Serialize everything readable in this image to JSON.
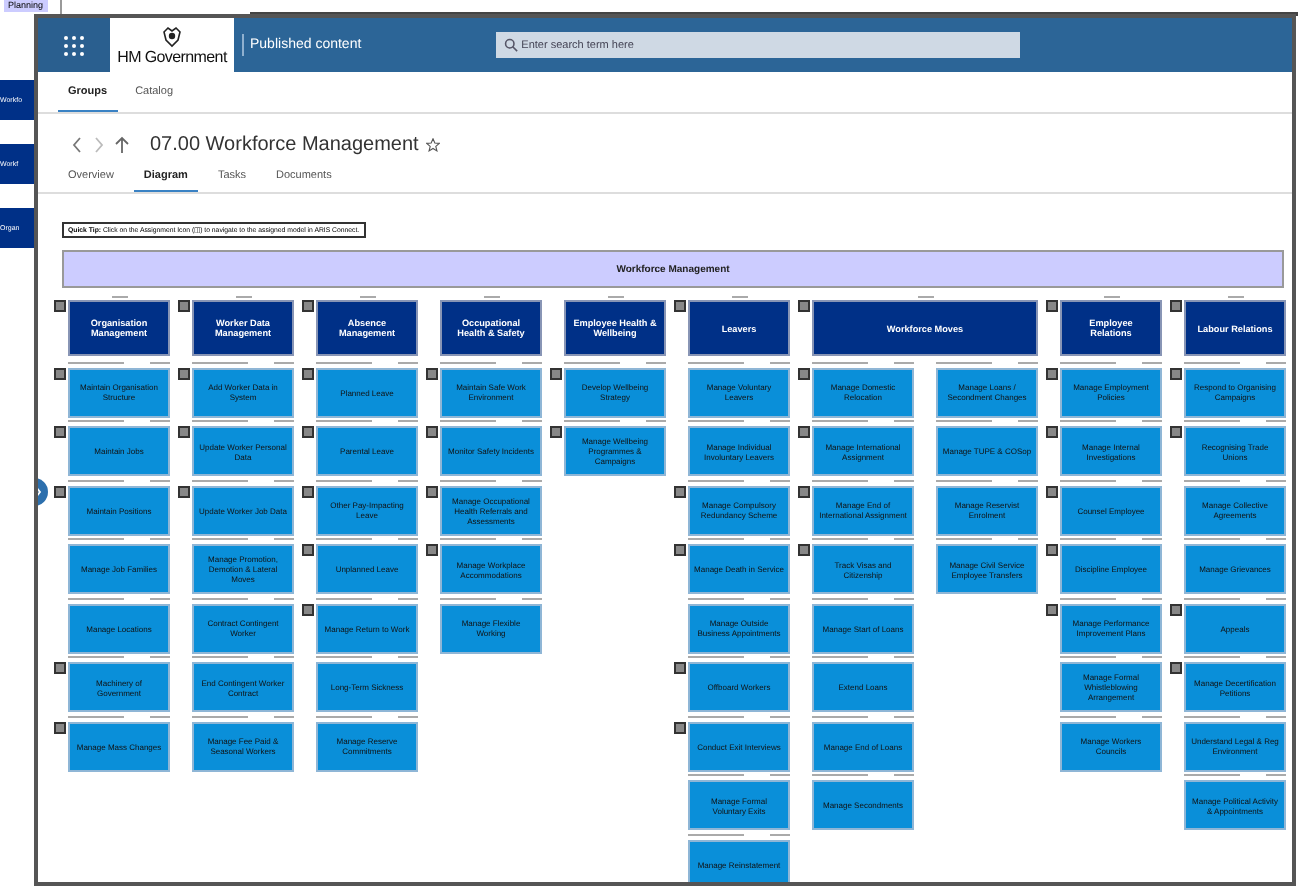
{
  "background_window": {
    "label": "Planning",
    "boxes": [
      "Workfo",
      "Workf",
      "Organ"
    ]
  },
  "header": {
    "brand": "HM Government",
    "section": "Published content",
    "search": {
      "placeholder": "Enter search term here"
    }
  },
  "top_tabs": [
    {
      "label": "Groups",
      "selected": true
    },
    {
      "label": "Catalog",
      "selected": false
    }
  ],
  "page": {
    "title": "07.00 Workforce Management",
    "favorite": false
  },
  "tabs": [
    {
      "label": "Overview",
      "selected": false
    },
    {
      "label": "Diagram",
      "selected": true
    },
    {
      "label": "Tasks",
      "selected": false
    },
    {
      "label": "Documents",
      "selected": false
    }
  ],
  "quick_tip": "**Quick Tip:** Click on the Assignment Icon (◫) to navigate to the assigned model in ARIS Connect.",
  "diagram": {
    "title": "Workforce Management",
    "groups": [
      {
        "title": "Organisation Management",
        "assigned": true,
        "columns": [
          [
            {
              "name": "Maintain Organisation Structure",
              "assigned": true
            },
            {
              "name": "Maintain Jobs",
              "assigned": true
            },
            {
              "name": "Maintain Positions",
              "assigned": true
            },
            {
              "name": "Manage Job Families",
              "assigned": false
            },
            {
              "name": "Manage Locations",
              "assigned": false
            },
            {
              "name": "Machinery of Government",
              "assigned": true
            },
            {
              "name": "Manage Mass Changes",
              "assigned": true
            }
          ]
        ]
      },
      {
        "title": "Worker Data Management",
        "assigned": true,
        "columns": [
          [
            {
              "name": "Add Worker Data in System",
              "assigned": true
            },
            {
              "name": "Update Worker Personal Data",
              "assigned": true
            },
            {
              "name": "Update Worker Job Data",
              "assigned": true
            },
            {
              "name": "Manage Promotion, Demotion & Lateral Moves",
              "assigned": false
            },
            {
              "name": "Contract Contingent Worker",
              "assigned": false
            },
            {
              "name": "End Contingent Worker Contract",
              "assigned": false
            },
            {
              "name": "Manage Fee Paid & Seasonal Workers",
              "assigned": false
            }
          ]
        ]
      },
      {
        "title": "Absence Management",
        "assigned": true,
        "columns": [
          [
            {
              "name": "Planned Leave",
              "assigned": true
            },
            {
              "name": "Parental Leave",
              "assigned": true
            },
            {
              "name": "Other Pay-Impacting Leave",
              "assigned": true
            },
            {
              "name": "Unplanned Leave",
              "assigned": true
            },
            {
              "name": "Manage Return to Work",
              "assigned": true
            },
            {
              "name": "Long-Term Sickness",
              "assigned": false
            },
            {
              "name": "Manage Reserve Commitments",
              "assigned": false
            }
          ]
        ]
      },
      {
        "title": "Occupational Health & Safety",
        "assigned": false,
        "columns": [
          [
            {
              "name": "Maintain Safe Work Environment",
              "assigned": true
            },
            {
              "name": "Monitor Safety Incidents",
              "assigned": true
            },
            {
              "name": "Manage Occupational Health Referrals and Assessments",
              "assigned": true
            },
            {
              "name": "Manage Workplace Accommodations",
              "assigned": true
            },
            {
              "name": "Manage Flexible Working",
              "assigned": false
            }
          ]
        ]
      },
      {
        "title": "Employee Health & Wellbeing",
        "assigned": false,
        "columns": [
          [
            {
              "name": "Develop Wellbeing Strategy",
              "assigned": true
            },
            {
              "name": "Manage Wellbeing Programmes & Campaigns",
              "assigned": true
            }
          ]
        ]
      },
      {
        "title": "Leavers",
        "assigned": true,
        "columns": [
          [
            {
              "name": "Manage Voluntary Leavers",
              "assigned": false
            },
            {
              "name": "Manage Individual Involuntary Leavers",
              "assigned": false
            },
            {
              "name": "Manage Compulsory Redundancy Scheme",
              "assigned": true
            },
            {
              "name": "Manage Death in Service",
              "assigned": true
            },
            {
              "name": "Manage Outside Business Appointments",
              "assigned": false
            },
            {
              "name": "Offboard Workers",
              "assigned": true
            },
            {
              "name": "Conduct Exit Interviews",
              "assigned": true
            },
            {
              "name": "Manage Formal Voluntary Exits",
              "assigned": false
            },
            {
              "name": "Manage Reinstatement",
              "assigned": false
            }
          ]
        ]
      },
      {
        "title": "Workforce Moves",
        "assigned": true,
        "columns": [
          [
            {
              "name": "Manage Domestic Relocation",
              "assigned": true
            },
            {
              "name": "Manage International Assignment",
              "assigned": true
            },
            {
              "name": "Manage End of International Assignment",
              "assigned": true
            },
            {
              "name": "Track Visas and Citizenship",
              "assigned": true
            },
            {
              "name": "Manage Start of Loans",
              "assigned": false
            },
            {
              "name": "Extend Loans",
              "assigned": false
            },
            {
              "name": "Manage End of Loans",
              "assigned": false
            },
            {
              "name": "Manage Secondments",
              "assigned": false
            }
          ],
          [
            {
              "name": "Manage Loans / Secondment Changes",
              "assigned": false
            },
            {
              "name": "Manage TUPE & COSop",
              "assigned": false
            },
            {
              "name": "Manage Reservist Enrolment",
              "assigned": false
            },
            {
              "name": "Manage Civil Service Employee Transfers",
              "assigned": false
            }
          ]
        ]
      },
      {
        "title": "Employee Relations",
        "assigned": true,
        "columns": [
          [
            {
              "name": "Manage Employment Policies",
              "assigned": true
            },
            {
              "name": "Manage Internal Investigations",
              "assigned": true
            },
            {
              "name": "Counsel Employee",
              "assigned": true
            },
            {
              "name": "Discipline Employee",
              "assigned": true
            },
            {
              "name": "Manage Performance Improvement Plans",
              "assigned": true
            },
            {
              "name": "Manage Formal Whistleblowing Arrangement",
              "assigned": false
            },
            {
              "name": "Manage Workers Councils",
              "assigned": false
            }
          ]
        ]
      },
      {
        "title": "Labour Relations",
        "assigned": true,
        "columns": [
          [
            {
              "name": "Respond to Organising Campaigns",
              "assigned": true
            },
            {
              "name": "Recognising Trade Unions",
              "assigned": true
            },
            {
              "name": "Manage Collective Agreements",
              "assigned": false
            },
            {
              "name": "Manage Grievances",
              "assigned": false
            },
            {
              "name": "Appeals",
              "assigned": true
            },
            {
              "name": "Manage Decertification Petitions",
              "assigned": true
            },
            {
              "name": "Understand Legal & Reg Environment",
              "assigned": false
            },
            {
              "name": "Manage Political Activity & Appointments",
              "assigned": false
            }
          ]
        ]
      }
    ]
  }
}
